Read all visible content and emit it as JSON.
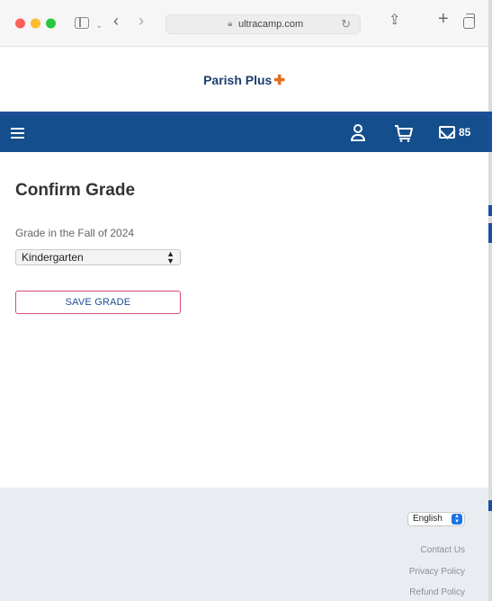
{
  "browser": {
    "address": "ultracamp.com"
  },
  "header": {
    "logo_text": "Parish Plus",
    "logo_symbol": "✚"
  },
  "navbar": {
    "message_count": "85"
  },
  "main": {
    "title": "Confirm Grade",
    "grade_label": "Grade in the Fall of 2024",
    "grade_value": "Kindergarten",
    "save_label": "SAVE GRADE"
  },
  "footer": {
    "language": "English",
    "links": [
      "Contact Us",
      "Privacy Policy",
      "Refund Policy"
    ]
  },
  "colors": {
    "navbar": "#144e8c",
    "accent_border": "#d24d7c",
    "logo_cross": "#e46c1d"
  }
}
